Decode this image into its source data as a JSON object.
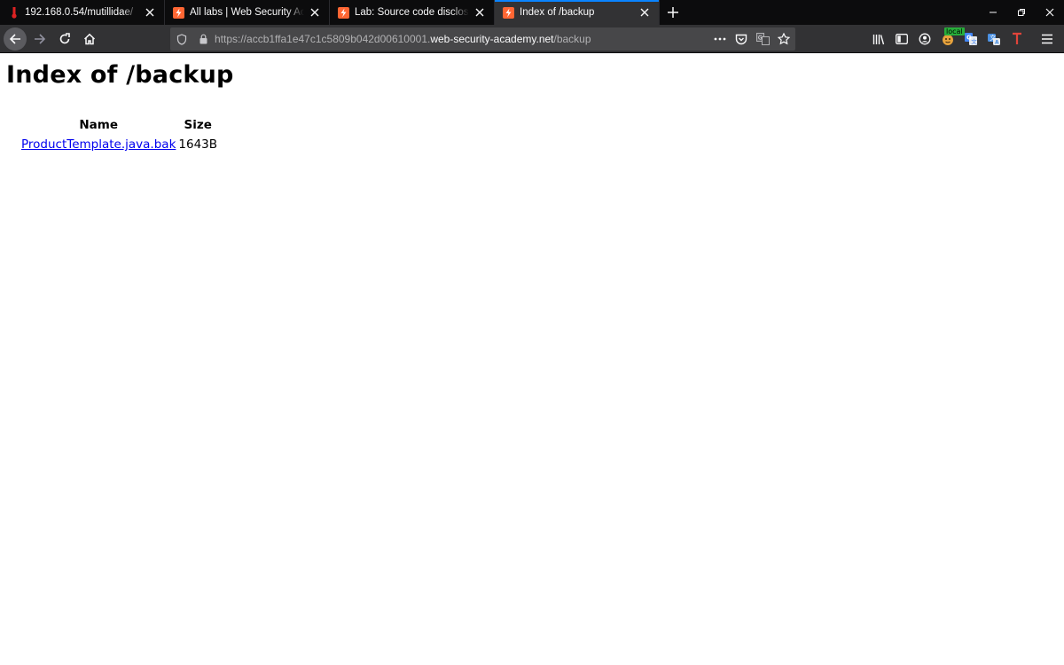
{
  "browser": {
    "tabs": [
      {
        "title": "192.168.0.54/mutillidae/",
        "favicon": "mutillidae-icon",
        "active": false
      },
      {
        "title": "All labs | Web Security Academy",
        "favicon": "portswigger-icon",
        "active": false
      },
      {
        "title": "Lab: Source code disclosure via backup files",
        "favicon": "portswigger-icon",
        "active": false
      },
      {
        "title": "Index of /backup",
        "favicon": "portswigger-icon",
        "active": true
      }
    ],
    "url": {
      "prefix": "https://accb1ffa1e47c1c5809b042d00610001.",
      "host": "web-security-academy.net",
      "path": "/backup"
    },
    "extension_badge": "local",
    "colors": {
      "accent": "#0a84ff",
      "favicon_orange": "#ff6633",
      "link": "#0000ee"
    }
  },
  "page": {
    "heading": "Index of /backup",
    "columns": {
      "name": "Name",
      "size": "Size"
    },
    "rows": [
      {
        "name": "ProductTemplate.java.bak",
        "size": "1643B"
      }
    ]
  }
}
